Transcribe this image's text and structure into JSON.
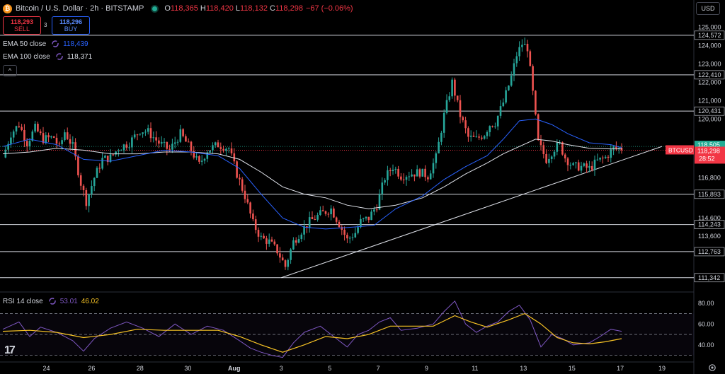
{
  "header": {
    "logo": "₿",
    "title": "Bitcoin / U.S. Dollar · 2h · BITSTAMP",
    "o_label": "O",
    "o": "118,365",
    "h_label": "H",
    "h": "118,420",
    "l_label": "L",
    "l": "118,132",
    "c_label": "C",
    "c": "118,298",
    "change": "−67 (−0.06%)"
  },
  "trade": {
    "sell_price": "118,293",
    "sell_label": "SELL",
    "spread": "3",
    "buy_price": "118,296",
    "buy_label": "BUY"
  },
  "legend": {
    "ema50_label": "EMA 50 close",
    "ema50_value": "118,439",
    "ema100_label": "EMA 100 close",
    "ema100_value": "118,371",
    "rsi_label": "RSI 14 close",
    "rsi_value": "53.01",
    "rsi_ma_value": "46.02",
    "collapse_icon": "^"
  },
  "currency": "USD",
  "colors": {
    "up": "#26a69a",
    "down": "#ef5350",
    "ema50": "#2962ff",
    "ema100": "#e0e3eb",
    "rsi": "#7e57c2",
    "rsi_ma": "#f7c325",
    "price_label": "#f23645",
    "green_label": "#22ab94"
  },
  "chart_data": {
    "type": "candlestick",
    "symbol": "BTCUSD",
    "interval": "2h",
    "price_axis": {
      "ylim": [
        110600,
        125800
      ],
      "ticks": [
        "125,000",
        "124,000",
        "123,000",
        "122,000",
        "121,000",
        "120,000",
        "116,800",
        "114,600",
        "113,600"
      ],
      "tick_values": [
        125000,
        124000,
        123000,
        122000,
        121000,
        120000,
        116800,
        114600,
        113600
      ]
    },
    "levels": [
      {
        "value": 124572,
        "label": "124,572"
      },
      {
        "value": 122410,
        "label": "122,410"
      },
      {
        "value": 120431,
        "label": "120,431"
      },
      {
        "value": 115893,
        "label": "115,893"
      },
      {
        "value": 114243,
        "label": "114,243"
      },
      {
        "value": 112763,
        "label": "112,763"
      },
      {
        "value": 111342,
        "label": "111,342"
      }
    ],
    "dotted_level": {
      "value": 118505,
      "label": "118,505"
    },
    "current": {
      "value": 118298,
      "label": "118,298",
      "symbol": "BTCUSD",
      "countdown": "28:52"
    },
    "trendline": {
      "start": {
        "date": "Aug 3",
        "price": 111342
      },
      "end": {
        "date": "Aug 19",
        "price": 118505
      }
    },
    "x_axis": {
      "ticks": [
        "24",
        "26",
        "28",
        "30",
        "Aug",
        "3",
        "5",
        "7",
        "9",
        "11",
        "13",
        "15",
        "17",
        "19"
      ]
    },
    "price_path": [
      [
        0,
        117900
      ],
      [
        3,
        119200
      ],
      [
        6,
        119700
      ],
      [
        9,
        118700
      ],
      [
        12,
        119500
      ],
      [
        15,
        118900
      ],
      [
        19,
        119000
      ],
      [
        21,
        118400
      ],
      [
        23,
        119300
      ],
      [
        26,
        118500
      ],
      [
        29,
        116500
      ],
      [
        31,
        115500
      ],
      [
        34,
        116800
      ],
      [
        37,
        117800
      ],
      [
        40,
        117900
      ],
      [
        43,
        118400
      ],
      [
        47,
        118700
      ],
      [
        51,
        119400
      ],
      [
        54,
        119300
      ],
      [
        58,
        118700
      ],
      [
        62,
        118300
      ],
      [
        66,
        119200
      ],
      [
        70,
        118300
      ],
      [
        73,
        117500
      ],
      [
        76,
        118300
      ],
      [
        80,
        118600
      ],
      [
        84,
        118400
      ],
      [
        87,
        117000
      ],
      [
        90,
        115800
      ],
      [
        93,
        114300
      ],
      [
        96,
        113500
      ],
      [
        99,
        113300
      ],
      [
        102,
        112800
      ],
      [
        105,
        111950
      ],
      [
        108,
        113300
      ],
      [
        111,
        113900
      ],
      [
        114,
        114400
      ],
      [
        118,
        114800
      ],
      [
        122,
        115100
      ],
      [
        125,
        114300
      ],
      [
        128,
        113400
      ],
      [
        131,
        113800
      ],
      [
        133,
        114400
      ],
      [
        136,
        114600
      ],
      [
        139,
        115300
      ],
      [
        142,
        116800
      ],
      [
        145,
        117400
      ],
      [
        148,
        116900
      ],
      [
        151,
        117000
      ],
      [
        155,
        117100
      ],
      [
        158,
        116900
      ],
      [
        161,
        117900
      ],
      [
        164,
        120200
      ],
      [
        167,
        122000
      ],
      [
        170,
        120200
      ],
      [
        173,
        119000
      ],
      [
        176,
        118900
      ],
      [
        179,
        119200
      ],
      [
        181,
        119700
      ],
      [
        183,
        119800
      ],
      [
        186,
        120900
      ],
      [
        189,
        122300
      ],
      [
        191,
        123500
      ],
      [
        193,
        124100
      ],
      [
        195,
        123900
      ],
      [
        197,
        121400
      ],
      [
        199,
        118700
      ],
      [
        202,
        117800
      ],
      [
        205,
        118400
      ],
      [
        207,
        118600
      ],
      [
        209,
        117900
      ],
      [
        212,
        117400
      ],
      [
        215,
        117400
      ],
      [
        218,
        117300
      ],
      [
        221,
        117700
      ],
      [
        224,
        117900
      ],
      [
        227,
        118400
      ],
      [
        230,
        118400
      ]
    ],
    "ema50_path": [
      [
        0,
        118500
      ],
      [
        10,
        118900
      ],
      [
        20,
        118600
      ],
      [
        30,
        117800
      ],
      [
        40,
        117700
      ],
      [
        50,
        118000
      ],
      [
        60,
        118300
      ],
      [
        70,
        118200
      ],
      [
        80,
        118000
      ],
      [
        88,
        117300
      ],
      [
        96,
        115900
      ],
      [
        104,
        114600
      ],
      [
        112,
        114100
      ],
      [
        120,
        114000
      ],
      [
        130,
        114100
      ],
      [
        138,
        114200
      ],
      [
        146,
        115100
      ],
      [
        156,
        115800
      ],
      [
        164,
        116700
      ],
      [
        172,
        117400
      ],
      [
        180,
        118000
      ],
      [
        186,
        118900
      ],
      [
        192,
        119900
      ],
      [
        198,
        120000
      ],
      [
        204,
        119700
      ],
      [
        210,
        119200
      ],
      [
        218,
        118700
      ],
      [
        226,
        118600
      ],
      [
        230,
        118439
      ]
    ],
    "ema100_path": [
      [
        0,
        118100
      ],
      [
        10,
        118200
      ],
      [
        20,
        118400
      ],
      [
        30,
        118300
      ],
      [
        40,
        118100
      ],
      [
        50,
        118100
      ],
      [
        60,
        118200
      ],
      [
        70,
        118200
      ],
      [
        80,
        118100
      ],
      [
        88,
        117800
      ],
      [
        96,
        117100
      ],
      [
        104,
        116300
      ],
      [
        112,
        115900
      ],
      [
        120,
        115700
      ],
      [
        128,
        115300
      ],
      [
        136,
        115100
      ],
      [
        146,
        115300
      ],
      [
        156,
        115700
      ],
      [
        164,
        116300
      ],
      [
        172,
        117000
      ],
      [
        180,
        117600
      ],
      [
        186,
        118100
      ],
      [
        192,
        118500
      ],
      [
        198,
        118900
      ],
      [
        204,
        118800
      ],
      [
        210,
        118600
      ],
      [
        218,
        118400
      ],
      [
        226,
        118370
      ],
      [
        230,
        118371
      ]
    ],
    "rsi_axis": {
      "ylim": [
        25,
        90
      ],
      "ticks": [
        "80.00",
        "60.00",
        "40.00"
      ],
      "tick_values": [
        80,
        60,
        40
      ],
      "bands": [
        70,
        50,
        30
      ]
    },
    "rsi_path": [
      [
        0,
        55
      ],
      [
        6,
        62
      ],
      [
        10,
        48
      ],
      [
        14,
        57
      ],
      [
        20,
        52
      ],
      [
        26,
        44
      ],
      [
        30,
        34
      ],
      [
        34,
        46
      ],
      [
        40,
        56
      ],
      [
        46,
        62
      ],
      [
        52,
        56
      ],
      [
        58,
        48
      ],
      [
        64,
        60
      ],
      [
        70,
        50
      ],
      [
        76,
        58
      ],
      [
        82,
        54
      ],
      [
        88,
        44
      ],
      [
        92,
        37
      ],
      [
        96,
        33
      ],
      [
        100,
        30
      ],
      [
        104,
        28
      ],
      [
        108,
        42
      ],
      [
        112,
        52
      ],
      [
        118,
        58
      ],
      [
        124,
        46
      ],
      [
        128,
        38
      ],
      [
        132,
        50
      ],
      [
        136,
        54
      ],
      [
        140,
        62
      ],
      [
        144,
        66
      ],
      [
        148,
        54
      ],
      [
        154,
        56
      ],
      [
        160,
        60
      ],
      [
        164,
        72
      ],
      [
        168,
        82
      ],
      [
        172,
        60
      ],
      [
        176,
        52
      ],
      [
        180,
        58
      ],
      [
        184,
        62
      ],
      [
        188,
        72
      ],
      [
        192,
        78
      ],
      [
        196,
        64
      ],
      [
        200,
        38
      ],
      [
        204,
        50
      ],
      [
        208,
        46
      ],
      [
        212,
        40
      ],
      [
        218,
        42
      ],
      [
        222,
        48
      ],
      [
        226,
        55
      ],
      [
        230,
        53
      ]
    ],
    "rsi_ma_path": [
      [
        0,
        53
      ],
      [
        10,
        54
      ],
      [
        20,
        52
      ],
      [
        30,
        47
      ],
      [
        40,
        50
      ],
      [
        50,
        55
      ],
      [
        60,
        54
      ],
      [
        70,
        54
      ],
      [
        80,
        54
      ],
      [
        88,
        48
      ],
      [
        96,
        40
      ],
      [
        104,
        33
      ],
      [
        112,
        40
      ],
      [
        120,
        48
      ],
      [
        128,
        46
      ],
      [
        136,
        50
      ],
      [
        144,
        58
      ],
      [
        152,
        58
      ],
      [
        160,
        58
      ],
      [
        168,
        68
      ],
      [
        174,
        62
      ],
      [
        180,
        57
      ],
      [
        188,
        64
      ],
      [
        194,
        70
      ],
      [
        200,
        60
      ],
      [
        206,
        47
      ],
      [
        212,
        42
      ],
      [
        218,
        41
      ],
      [
        224,
        43
      ],
      [
        230,
        46
      ]
    ]
  }
}
